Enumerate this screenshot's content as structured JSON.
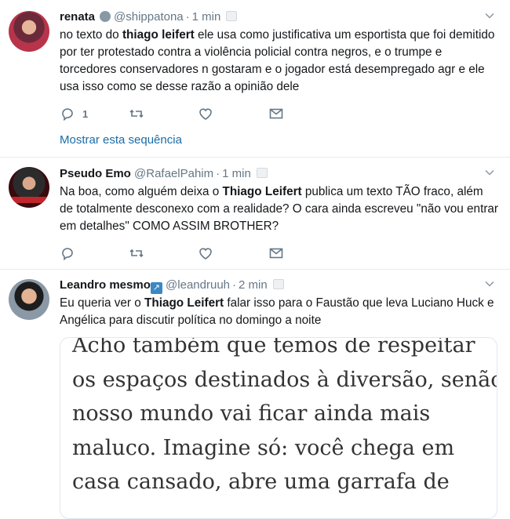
{
  "tweets": [
    {
      "name": "renata",
      "handle": "@shippatona",
      "time": "1 min",
      "text_parts": [
        "no texto do ",
        "thiago leifert",
        " ele usa como justificativa um esportista que foi demitido por ter protestado contra a violência policial contra negros, e o trumpe e torcedores conservadores n gostaram e o jogador está desempregado agr e ele usa isso como se desse razão a opinião dele"
      ],
      "reply_count": "1",
      "show_thread": "Mostrar esta sequência"
    },
    {
      "name": "Pseudo Emo",
      "handle": "@RafaelPahim",
      "time": "1 min",
      "text_parts": [
        "Na boa, como alguém deixa o ",
        "Thiago Leifert",
        " publica um texto TÃO fraco, além de totalmente desconexo com a realidade? O cara ainda escreveu \"não vou entrar em detalhes\" COMO ASSIM BROTHER?"
      ]
    },
    {
      "name": "Leandro mesmo",
      "name_emoji": "↗",
      "handle": "@leandruuh",
      "time": "2 min",
      "text_parts": [
        "Eu queria ver o ",
        "Thiago Leifert",
        " falar isso para o Faustão que leva Luciano Huck e Angélica para discutir política no domingo a noite"
      ],
      "card_lines": [
        "Acho também que temos de respeitar",
        "os espaços destinados à diversão, senão",
        "nosso mundo vai ficar ainda mais",
        "maluco. Imagine só: você chega em",
        "casa cansado, abre uma garrafa de"
      ]
    }
  ],
  "colors": {
    "link": "#1b6ca8",
    "muted": "#657786",
    "border": "#e6ecf0"
  },
  "icons": [
    "reply-icon",
    "retweet-icon",
    "like-icon",
    "message-icon",
    "chevron-down-icon",
    "phone-icon"
  ]
}
